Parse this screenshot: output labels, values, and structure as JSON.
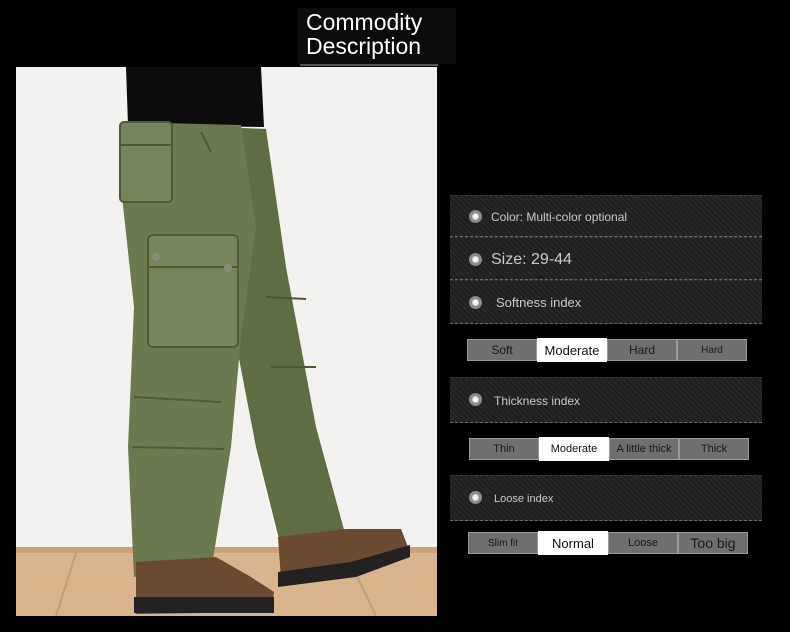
{
  "header": {
    "title_line1": "Commodity",
    "title_line2": "Description"
  },
  "photo": {
    "subject": "olive green cargo pants with brown hiking shoes"
  },
  "specs": {
    "color": "Color: Multi-color optional",
    "size": "Size: 29-44",
    "softness_label": "Softness index",
    "thickness_label": "Thickness index",
    "loose_label": "Loose index"
  },
  "softness": {
    "options": [
      "Soft",
      "Moderate",
      "Hard",
      "Hard"
    ],
    "selected": 1
  },
  "thickness": {
    "options": [
      "Thin",
      "Moderate",
      "A little thick",
      "Thick"
    ],
    "selected": 1
  },
  "loose": {
    "options": [
      "Slim fit",
      "Normal",
      "Loose",
      "Too big"
    ],
    "selected": 1
  },
  "colors": {
    "pants": "#6b7a4e",
    "shoe": "#6b4a30",
    "active_segment": "#ffffff",
    "inactive_segment": "#6f6f6f"
  }
}
